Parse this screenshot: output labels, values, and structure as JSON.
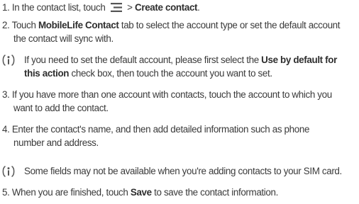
{
  "steps": {
    "s1": {
      "num": "1.",
      "pre": "In the contact list, touch",
      "mid": " > ",
      "bold": "Create contact",
      "post": ".",
      "icon": "menu-icon"
    },
    "s2": {
      "num": "2.",
      "pre": "Touch ",
      "bold": "MobileLife Contact",
      "post1": " tab to select the account type or set the default account",
      "line2": "the contact will sync with."
    },
    "s3": {
      "num": "3.",
      "line1": "If you have more than one account with contacts, touch the account to which you",
      "line2": "want to add the contact."
    },
    "s4": {
      "num": "4.",
      "line1": "Enter the contact's name, and then add detailed information such as phone",
      "line2": "number and address."
    },
    "s5": {
      "num": "5.",
      "pre": "When you are finished, touch ",
      "bold": "Save",
      "post": " to save the contact information."
    }
  },
  "notes": {
    "n1": {
      "icon": "note-icon",
      "pre": "If you need to set the default account, please first select the ",
      "bold1": "Use by default for",
      "bold2": "this action",
      "post": " check box, then touch the account you want to set."
    },
    "n2": {
      "icon": "note-icon",
      "text": "Some fields may not be available when you're adding contacts to your SIM card."
    }
  },
  "colors": {
    "text": "#3a3a3a",
    "icon": "#555555"
  }
}
